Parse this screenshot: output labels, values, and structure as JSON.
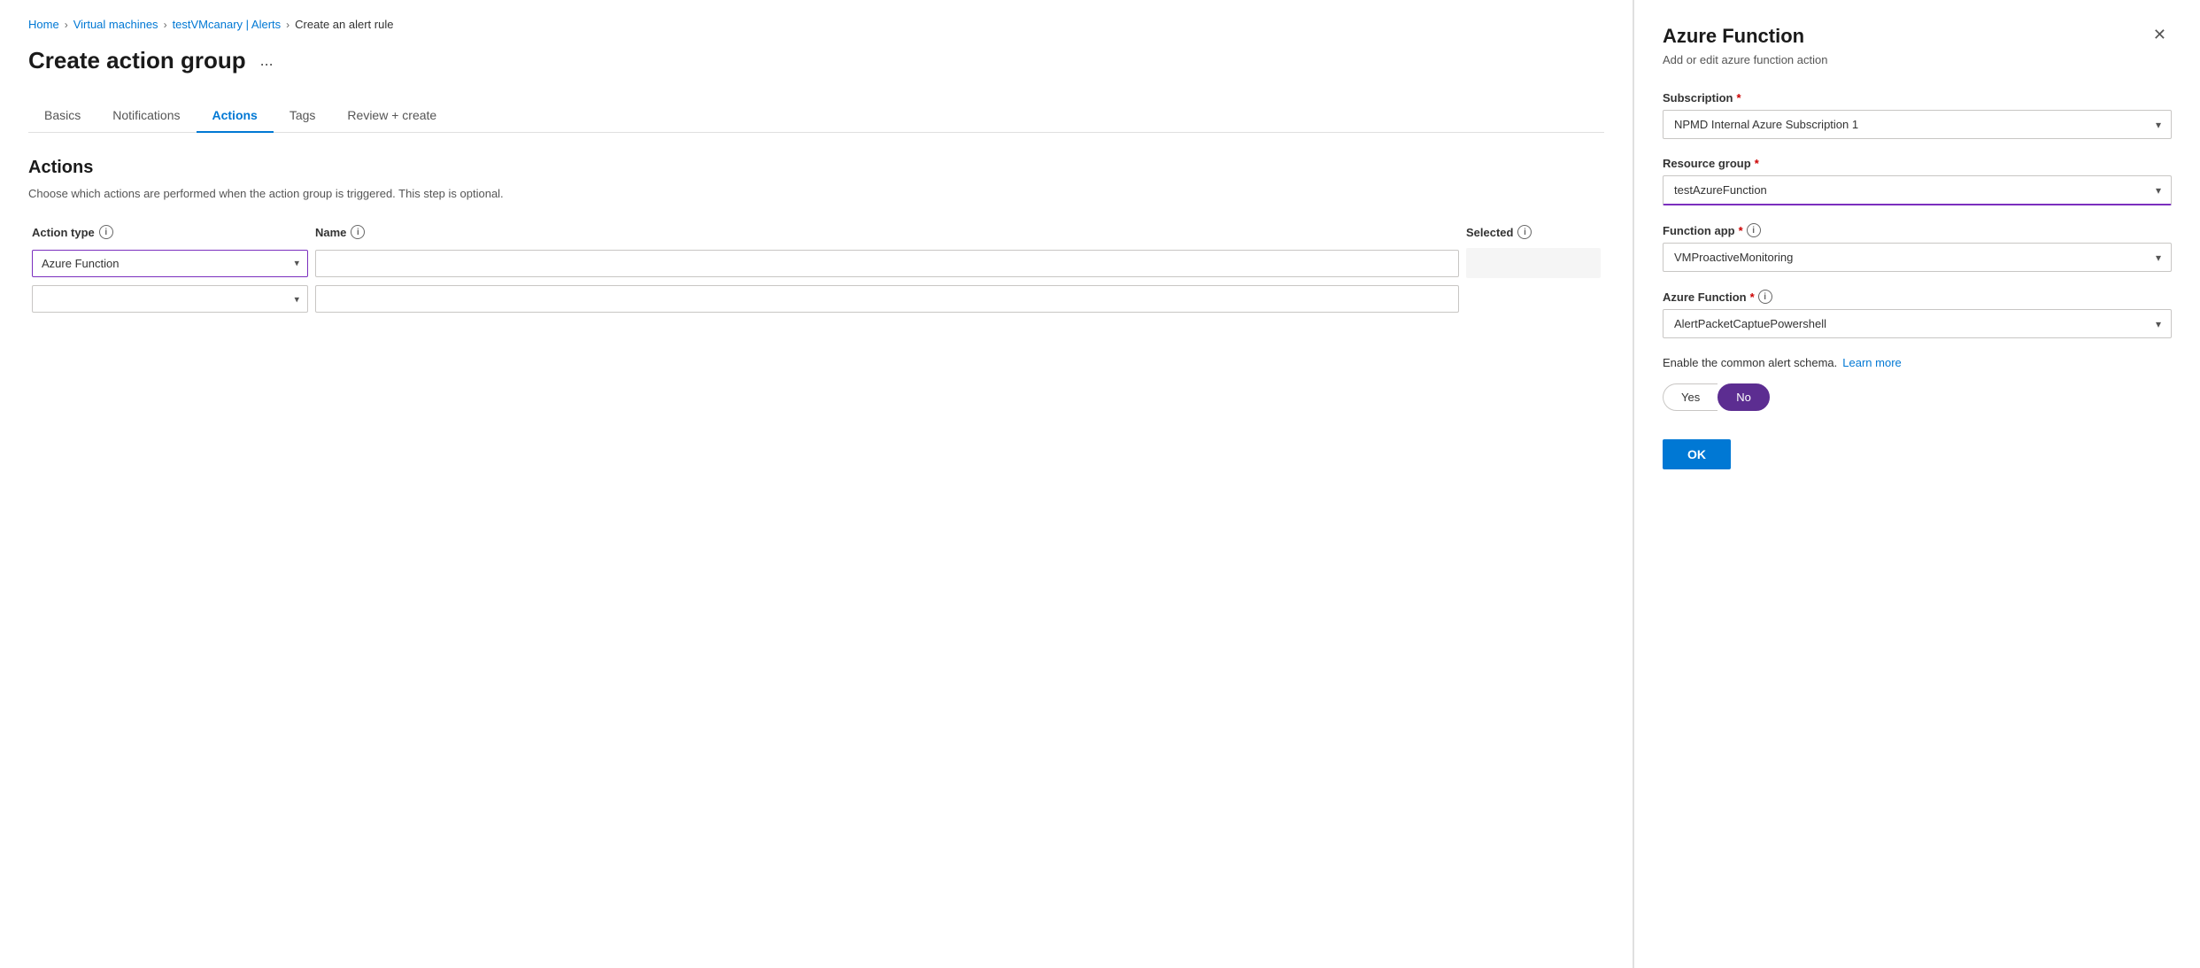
{
  "breadcrumb": {
    "items": [
      {
        "label": "Home",
        "link": true
      },
      {
        "label": "Virtual machines",
        "link": true
      },
      {
        "label": "testVMcanary | Alerts",
        "link": true
      },
      {
        "label": "Create an alert rule",
        "link": true
      }
    ]
  },
  "page_title": "Create action group",
  "ellipsis_label": "...",
  "tabs": [
    {
      "label": "Basics",
      "active": false
    },
    {
      "label": "Notifications",
      "active": false
    },
    {
      "label": "Actions",
      "active": true
    },
    {
      "label": "Tags",
      "active": false
    },
    {
      "label": "Review + create",
      "active": false
    }
  ],
  "section": {
    "title": "Actions",
    "description": "Choose which actions are performed when the action group is triggered. This step is optional."
  },
  "table": {
    "headers": {
      "action_type": "Action type",
      "name": "Name",
      "selected": "Selected"
    },
    "rows": [
      {
        "action_type_value": "Azure Function",
        "name_value": "",
        "name_placeholder": "",
        "selected_value": ""
      },
      {
        "action_type_value": "",
        "name_value": "",
        "name_placeholder": "",
        "selected_value": ""
      }
    ]
  },
  "right_panel": {
    "title": "Azure Function",
    "subtitle": "Add or edit azure function action",
    "fields": {
      "subscription": {
        "label": "Subscription",
        "required": true,
        "value": "NPMD Internal Azure Subscription 1",
        "options": [
          "NPMD Internal Azure Subscription 1"
        ]
      },
      "resource_group": {
        "label": "Resource group",
        "required": true,
        "value": "testAzureFunction",
        "focused": true,
        "options": [
          "testAzureFunction"
        ]
      },
      "function_app": {
        "label": "Function app",
        "required": true,
        "value": "VMProactiveMonitoring",
        "options": [
          "VMProactiveMonitoring"
        ]
      },
      "azure_function": {
        "label": "Azure Function",
        "required": true,
        "value": "AlertPacketCaptuePowershell",
        "options": [
          "AlertPacketCaptuePowershell"
        ]
      }
    },
    "enable_schema": {
      "label": "Enable the common alert schema.",
      "learn_more": "Learn more",
      "toggle": {
        "yes_label": "Yes",
        "no_label": "No",
        "selected": "No"
      }
    },
    "ok_button_label": "OK"
  }
}
